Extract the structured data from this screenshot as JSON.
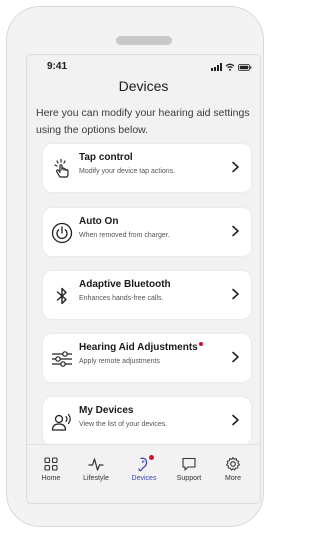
{
  "status_bar": {
    "time": "9:41"
  },
  "header": {
    "title": "Devices"
  },
  "intro_text": "Here you can modify your hearing aid settings using the options below.",
  "cards": [
    {
      "title": "Tap control",
      "subtitle": "Modify your device tap actions.",
      "icon": "tap-hand-icon",
      "has_alert": false
    },
    {
      "title": "Auto On",
      "subtitle": "When removed from charger.",
      "icon": "power-icon",
      "has_alert": false
    },
    {
      "title": "Adaptive Bluetooth",
      "subtitle": "Enhances hands-free calls.",
      "icon": "bluetooth-icon",
      "has_alert": false
    },
    {
      "title": "Hearing Aid Adjustments",
      "subtitle": "Apply remote adjustments",
      "icon": "sliders-icon",
      "has_alert": true
    },
    {
      "title": "My Devices",
      "subtitle": "View the list of your devices.",
      "icon": "person-sound-icon",
      "has_alert": false
    }
  ],
  "tabs": [
    {
      "label": "Home",
      "icon": "grid-icon",
      "active": false
    },
    {
      "label": "Lifestyle",
      "icon": "pulse-icon",
      "active": false
    },
    {
      "label": "Devices",
      "icon": "hearing-aid-icon",
      "active": true,
      "has_alert": true
    },
    {
      "label": "Support",
      "icon": "chat-icon",
      "active": false
    },
    {
      "label": "More",
      "icon": "gear-icon",
      "active": false
    }
  ],
  "colors": {
    "accent": "#3b45b5",
    "alert": "#d0112b",
    "card_bg": "#ffffff",
    "screen_bg": "#f2f2f2"
  }
}
